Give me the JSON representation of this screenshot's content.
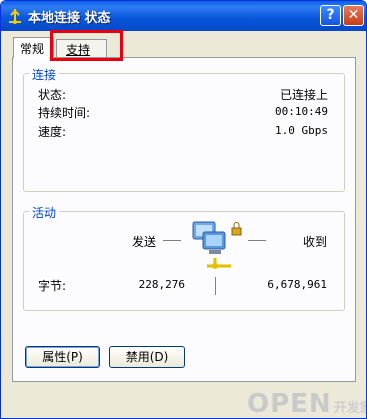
{
  "window": {
    "title": "本地连接 状态",
    "help_glyph": "?",
    "close_glyph": "✕"
  },
  "tabs": [
    {
      "label": "常规"
    },
    {
      "label": "支持"
    }
  ],
  "connection": {
    "group_title": "连接",
    "rows": [
      {
        "label": "状态:",
        "value": "已连接上"
      },
      {
        "label": "持续时间:",
        "value": "00:10:49"
      },
      {
        "label": "速度:",
        "value": "1.0 Gbps"
      }
    ]
  },
  "activity": {
    "group_title": "活动",
    "sent_label": "发送",
    "received_label": "收到",
    "bytes_label": "字节:",
    "bytes_sent": "228,276",
    "bytes_received": "6,678,961"
  },
  "buttons": {
    "properties": "属性(P)",
    "disable": "禁用(D)"
  },
  "watermark": {
    "brand": "OPEN",
    "site": "开发家园"
  },
  "colors": {
    "titlebar": "#0a58dc",
    "group_title": "#0046d5",
    "highlight": "#e8000f"
  }
}
